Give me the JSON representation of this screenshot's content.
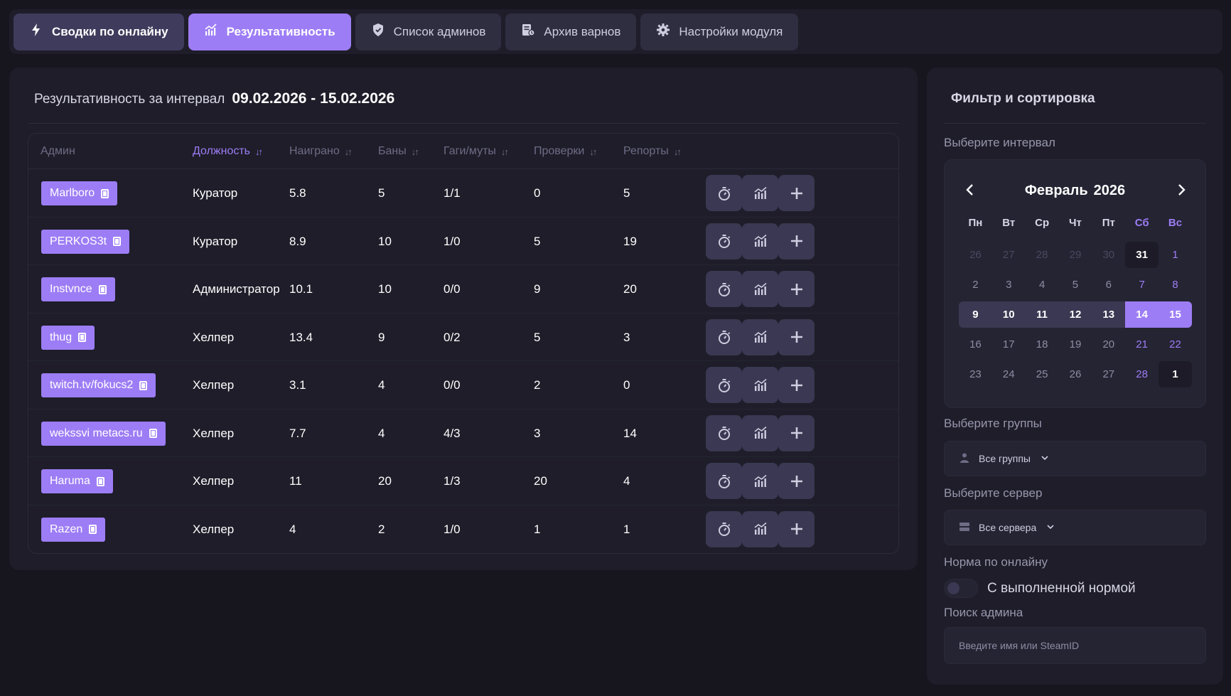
{
  "nav": {
    "tabs": [
      {
        "label": "Сводки по онлайну",
        "icon": "lightning-icon"
      },
      {
        "label": "Результативность",
        "icon": "chart-icon"
      },
      {
        "label": "Список админов",
        "icon": "shield-icon"
      },
      {
        "label": "Архив варнов",
        "icon": "archive-icon"
      },
      {
        "label": "Настройки модуля",
        "icon": "gear-icon"
      }
    ]
  },
  "main": {
    "title_label": "Результативность за интервал",
    "title_range": "09.02.2026 - 15.02.2026",
    "columns": [
      "Админ",
      "Должность",
      "Наиграно",
      "Баны",
      "Гаги/муты",
      "Проверки",
      "Репорты"
    ],
    "rows": [
      {
        "admin": "Marlboro",
        "role": "Куратор",
        "played": "5.8",
        "bans": "5",
        "gags": "1/1",
        "checks": "0",
        "reports": "5"
      },
      {
        "admin": "PERKOS3t",
        "role": "Куратор",
        "played": "8.9",
        "bans": "10",
        "gags": "1/0",
        "checks": "5",
        "reports": "19"
      },
      {
        "admin": "Instvnce",
        "role": "Администратор",
        "played": "10.1",
        "bans": "10",
        "gags": "0/0",
        "checks": "9",
        "reports": "20"
      },
      {
        "admin": "thug",
        "role": "Хелпер",
        "played": "13.4",
        "bans": "9",
        "gags": "0/2",
        "checks": "5",
        "reports": "3"
      },
      {
        "admin": "twitch.tv/fokucs2",
        "role": "Хелпер",
        "played": "3.1",
        "bans": "4",
        "gags": "0/0",
        "checks": "2",
        "reports": "0"
      },
      {
        "admin": "wekssvi metacs.ru",
        "role": "Хелпер",
        "played": "7.7",
        "bans": "4",
        "gags": "4/3",
        "checks": "3",
        "reports": "14"
      },
      {
        "admin": "Haruma",
        "role": "Хелпер",
        "played": "11",
        "bans": "20",
        "gags": "1/3",
        "checks": "20",
        "reports": "4"
      },
      {
        "admin": "Razen",
        "role": "Хелпер",
        "played": "4",
        "bans": "2",
        "gags": "1/0",
        "checks": "1",
        "reports": "1"
      }
    ]
  },
  "side": {
    "title": "Фильтр и сортировка",
    "interval_label": "Выберите интервал",
    "calendar": {
      "month": "Февраль",
      "year": "2026",
      "weekdays": [
        "Пн",
        "Вт",
        "Ср",
        "Чт",
        "Пт",
        "Сб",
        "Вс"
      ],
      "weeks": [
        [
          "26",
          "27",
          "28",
          "29",
          "30",
          "31",
          "1"
        ],
        [
          "2",
          "3",
          "4",
          "5",
          "6",
          "7",
          "8"
        ],
        [
          "9",
          "10",
          "11",
          "12",
          "13",
          "14",
          "15"
        ],
        [
          "16",
          "17",
          "18",
          "19",
          "20",
          "21",
          "22"
        ],
        [
          "23",
          "24",
          "25",
          "26",
          "27",
          "28",
          "1"
        ]
      ]
    },
    "groups_label": "Выберите группы",
    "groups_value": "Все группы",
    "server_label": "Выберите сервер",
    "server_value": "Все сервера",
    "norm_label": "Норма по онлайну",
    "norm_toggle_label": "С выполненной нормой",
    "search_label": "Поиск админа",
    "search_placeholder": "Введите имя или SteamID"
  },
  "colors": {
    "accent": "#9d7df5",
    "background": "#17161f",
    "panel": "#1e1d29",
    "button": "#3a3852"
  }
}
